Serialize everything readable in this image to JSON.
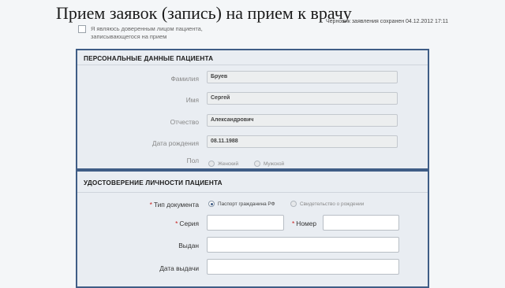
{
  "page": {
    "title": "Прием заявок (запись) на прием к врачу",
    "draft_status": "Черновик заявления сохранен 04.12.2012 17:11"
  },
  "proxy": {
    "label": "Я являюсь доверенным лицом пациента, записывающегося на прием",
    "checked": false
  },
  "personal": {
    "title": "ПЕРСОНАЛЬНЫЕ ДАННЫЕ ПАЦИЕНТА",
    "surname": {
      "label": "Фамилия",
      "value": "Бруев"
    },
    "name": {
      "label": "Имя",
      "value": "Сергей"
    },
    "patronymic": {
      "label": "Отчество",
      "value": "Александрович"
    },
    "birthdate": {
      "label": "Дата рождения",
      "value": "08.11.1988"
    },
    "gender": {
      "label": "Пол",
      "options": [
        "Женский",
        "Мужской"
      ],
      "selected": null
    }
  },
  "identity": {
    "title": "УДОСТОВЕРЕНИЕ ЛИЧНОСТИ ПАЦИЕНТА",
    "doc_type": {
      "label": "Тип документа",
      "options": [
        "Паспорт гражданина РФ",
        "Свидетельство о рождении"
      ],
      "selected": "Паспорт гражданина РФ"
    },
    "series": {
      "label": "Серия",
      "value": ""
    },
    "number": {
      "label": "Номер",
      "value": ""
    },
    "issued_by": {
      "label": "Выдан",
      "value": ""
    },
    "issue_date": {
      "label": "Дата выдачи",
      "value": ""
    },
    "required_mark": "*"
  },
  "colors": {
    "section_border": "#3f5d86",
    "section_bg": "#e9edf2",
    "required": "#c8201e"
  }
}
